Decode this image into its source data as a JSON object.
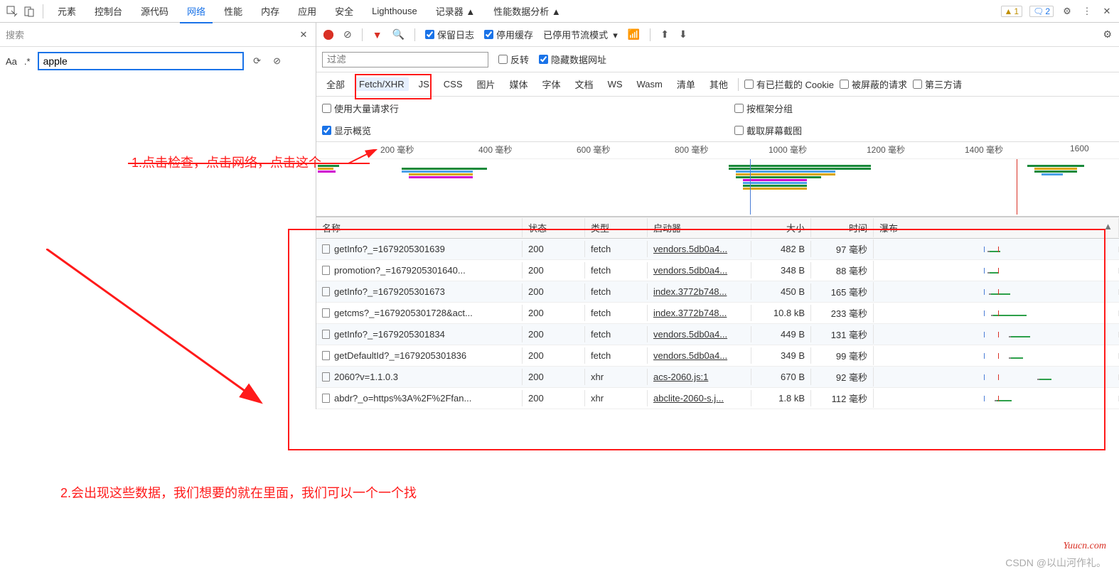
{
  "tabs": [
    "元素",
    "控制台",
    "源代码",
    "网络",
    "性能",
    "内存",
    "应用",
    "安全",
    "Lighthouse",
    "记录器 ▲",
    "性能数据分析 ▲"
  ],
  "active_tab": 3,
  "top_right": {
    "warn_count": "1",
    "info_count": "2"
  },
  "search": {
    "placeholder": "搜索",
    "aa": "Aa",
    "regex": ".*",
    "value": "apple"
  },
  "net_toolbar": {
    "preserve_log": "保留日志",
    "disable_cache": "停用缓存",
    "throttle": "已停用节流模式"
  },
  "filter_row": {
    "filter_placeholder": "过滤",
    "invert": "反转",
    "hide_data": "隐藏数据网址"
  },
  "types": [
    "全部",
    "Fetch/XHR",
    "JS",
    "CSS",
    "图片",
    "媒体",
    "字体",
    "文档",
    "WS",
    "Wasm",
    "清单",
    "其他"
  ],
  "type_checks": {
    "blocked_cookie": "有已拦截的 Cookie",
    "blocked_req": "被屏蔽的请求",
    "third_party": "第三方请"
  },
  "opts": {
    "large_rows": "使用大量请求行",
    "group_frame": "按框架分组",
    "show_overview": "显示概览",
    "screenshot": "截取屏幕截图"
  },
  "timeline_labels": [
    "200 毫秒",
    "400 毫秒",
    "600 毫秒",
    "800 毫秒",
    "1000 毫秒",
    "1200 毫秒",
    "1400 毫秒",
    "1600"
  ],
  "columns": {
    "name": "名称",
    "status": "状态",
    "type": "类型",
    "initiator": "启动器",
    "size": "大小",
    "time": "时间",
    "waterfall": "瀑布"
  },
  "rows": [
    {
      "name": "getInfo?_=1679205301639",
      "status": "200",
      "type": "fetch",
      "initiator": "vendors.5db0a4...",
      "size": "482 B",
      "time": "97 毫秒"
    },
    {
      "name": "promotion?_=1679205301640...",
      "status": "200",
      "type": "fetch",
      "initiator": "vendors.5db0a4...",
      "size": "348 B",
      "time": "88 毫秒"
    },
    {
      "name": "getInfo?_=1679205301673",
      "status": "200",
      "type": "fetch",
      "initiator": "index.3772b748...",
      "size": "450 B",
      "time": "165 毫秒"
    },
    {
      "name": "getcms?_=1679205301728&act...",
      "status": "200",
      "type": "fetch",
      "initiator": "index.3772b748...",
      "size": "10.8 kB",
      "time": "233 毫秒"
    },
    {
      "name": "getInfo?_=1679205301834",
      "status": "200",
      "type": "fetch",
      "initiator": "vendors.5db0a4...",
      "size": "449 B",
      "time": "131 毫秒"
    },
    {
      "name": "getDefaultId?_=1679205301836",
      "status": "200",
      "type": "fetch",
      "initiator": "vendors.5db0a4...",
      "size": "349 B",
      "time": "99 毫秒"
    },
    {
      "name": "2060?v=1.1.0.3",
      "status": "200",
      "type": "xhr",
      "initiator": "acs-2060.js:1",
      "size": "670 B",
      "time": "92 毫秒"
    },
    {
      "name": "abdr?_o=https%3A%2F%2Ffan...",
      "status": "200",
      "type": "xhr",
      "initiator": "abclite-2060-s.j...",
      "size": "1.8 kB",
      "time": "112 毫秒"
    }
  ],
  "annotations": {
    "step1": "1.点击检查，点击网络，点击这个",
    "step2": "2.会出现这些数据，我们想要的就在里面，我们可以一个一个找"
  },
  "watermark1": "Yuucn.com",
  "watermark2": "CSDN @以山河作礼。"
}
